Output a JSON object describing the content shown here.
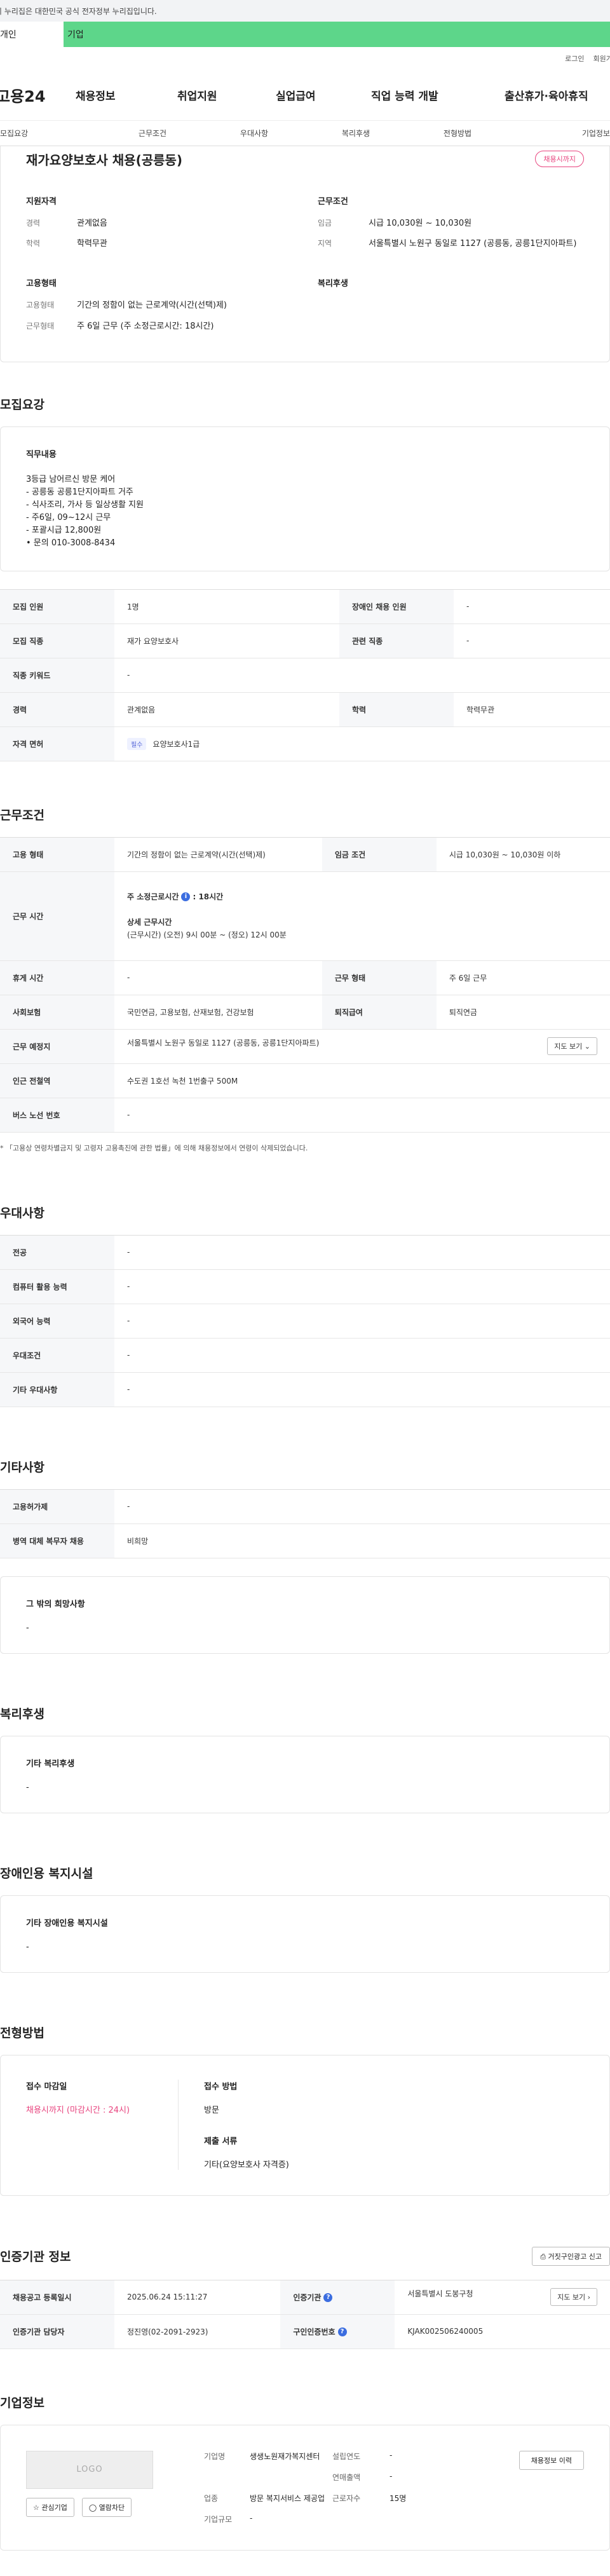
{
  "gov_banner": "이 누리집은 대한민국 공식 전자정부 누리집입니다.",
  "user_tabs": [
    "개인",
    "기업"
  ],
  "util": [
    "로그인",
    "회원가입"
  ],
  "logo": "고용24",
  "gnb": [
    "채용정보",
    "취업지원",
    "실업급여",
    "직업 능력 개발",
    "출산휴가·육아휴직"
  ],
  "anchor_tabs": [
    "모집요강",
    "근무조건",
    "우대사항",
    "복리후생",
    "전형방법",
    "기업정보"
  ],
  "summary": {
    "title": "재가요양보호사 채용(공릉동)",
    "badge": "채용시까지",
    "qualification_h": "지원자격",
    "career_k": "경력",
    "career_v": "관계없음",
    "edu_k": "학력",
    "edu_v": "학력무관",
    "condition_h": "근무조건",
    "wage_k": "임금",
    "wage_v": "시급 10,030원 ~ 10,030원",
    "region_k": "지역",
    "region_v": "서울특별시 노원구 동일로 1127 (공릉동, 공릉1단지아파트)",
    "employ_h": "고용형태",
    "type_k": "고용형태",
    "type_v": "기간의 정함이 없는 근로계약(시간(선택)제)",
    "worktype_k": "근무형태",
    "worktype_v": "주 6일 근무 (주 소정근로시간: 18시간)",
    "welfare_h": "복리후생"
  },
  "recruit": {
    "title": "모집요강",
    "duty_h": "직무내용",
    "duty_text": "3등급 남어르신 방문 케어\n- 공릉동 공릉1단지아파트 거주\n- 식사조리, 가사 등 일상생활 지원\n- 주6일, 09~12시 근무\n- 포괄시급 12,800원\n• 문의 010-3008-8434",
    "rows": {
      "headcount_k": "모집 인원",
      "headcount_v": "1명",
      "disabled_k": "장애인 채용 인원",
      "disabled_v": "-",
      "job_k": "모집 직종",
      "job_v": "재가 요양보호사",
      "related_k": "관련 직종",
      "related_v": "-",
      "keyword_k": "직종 키워드",
      "keyword_v": "-",
      "career_k": "경력",
      "career_v": "관계없음",
      "edu_k": "학력",
      "edu_v": "학력무관",
      "license_k": "자격 면허",
      "license_tag": "필수",
      "license_v": "요양보호사1급"
    }
  },
  "conditions": {
    "title": "근무조건",
    "type_k": "고용 형태",
    "type_v": "기간의 정함이 없는 근로계약(시간(선택)제)",
    "wage_k": "임금 조건",
    "wage_v": "시급 10,030원 ~ 10,030원 이하",
    "hours_k": "근무 시간",
    "hours_weekly": "주 소정근로시간",
    "hours_weekly_v": ": 18시간",
    "hours_detail_h": "상세 근무시간",
    "hours_detail_v": "(근무시간) (오전) 9시 00분 ~ (정오) 12시 00분",
    "break_k": "휴게 시간",
    "break_v": "-",
    "form_k": "근무 형태",
    "form_v": "주 6일 근무",
    "insurance_k": "사회보험",
    "insurance_v": "국민연금, 고용보험, 산재보험, 건강보험",
    "severance_k": "퇴직급여",
    "severance_v": "퇴직연금",
    "place_k": "근무 예정지",
    "place_v": "서울특별시 노원구 동일로 1127 (공릉동, 공릉1단지아파트)",
    "map_btn": "지도 보기",
    "subway_k": "인근 전철역",
    "subway_v": "수도권 1호선 녹천 1번출구 500M",
    "bus_k": "버스 노선 번호",
    "bus_v": "-",
    "note": "* 「고용상 연령차별금지 및 고령자 고용촉진에 관한 법률」에 의해 채용정보에서 연령이 삭제되었습니다."
  },
  "preferences": {
    "title": "우대사항",
    "major_k": "전공",
    "major_v": "-",
    "computer_k": "컴퓨터 활용 능력",
    "computer_v": "-",
    "lang_k": "외국어 능력",
    "lang_v": "-",
    "cond_k": "우대조건",
    "cond_v": "-",
    "etc_k": "기타 우대사항",
    "etc_v": "-"
  },
  "other": {
    "title": "기타사항",
    "welfare_ins_k": "고용허가제",
    "welfare_ins_v": "-",
    "military_k": "병역 대체 복무자 채용",
    "military_v": "비희망",
    "wish_h": "그 밖의 희망사항",
    "wish_v": "-"
  },
  "welfare": {
    "title": "복리후생",
    "h": "기타 복리후생",
    "v": "-"
  },
  "disability": {
    "title": "장애인용 복지시설",
    "h": "기타 장애인용 복지시설",
    "v": "-"
  },
  "method": {
    "title": "전형방법",
    "deadline_h": "접수 마감일",
    "deadline_v": "채용시까지 (마감시간 : 24시)",
    "apply_h": "접수 방법",
    "apply_v": "방문",
    "docs_h": "제출 서류",
    "docs_v": "기타(요양보호사 자격증)"
  },
  "cert": {
    "title": "인증기관 정보",
    "report_btn": "거짓구인광고 신고",
    "reg_k": "채용공고 등록일시",
    "reg_v": "2025.06.24 15:11:27",
    "org_k": "인증기관",
    "org_v": "서울특별시 도봉구청",
    "map_btn": "지도 보기",
    "manager_k": "인증기관 담당자",
    "manager_v": "정진영(02-2091-2923)",
    "certno_k": "구인인증번호",
    "certno_v": "KJAK002506240005"
  },
  "company": {
    "title": "기업정보",
    "logo": "LOGO",
    "fav_btn": "관심기업",
    "block_btn": "열람차단",
    "name_k": "기업명",
    "name_v": "생생노원재가복지센터",
    "year_k": "설립연도",
    "year_v": "-",
    "sales_k": "연매출액",
    "sales_v": "-",
    "industry_k": "업종",
    "industry_v": "방문 복지서비스 제공업",
    "workers_k": "근로자수",
    "workers_v": "15명",
    "size_k": "기업규모",
    "size_v": "-",
    "history_btn": "채용정보 이력"
  }
}
